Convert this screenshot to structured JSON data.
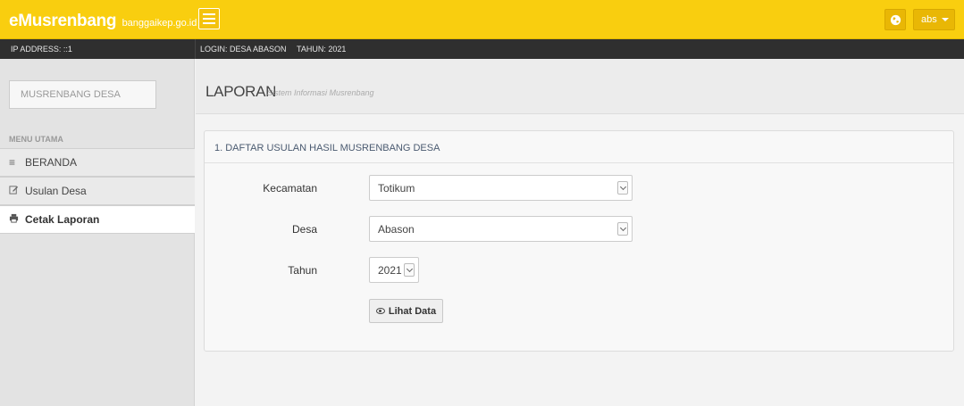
{
  "brand": {
    "name": "eMusrenbang",
    "domain": "banggaikep.go.id"
  },
  "topbar": {
    "user_label": "abs",
    "accent": "#f9ce0f"
  },
  "infobar": {
    "ip": "IP ADDRESS: ::1",
    "login": "LOGIN: DESA ABASON",
    "tahun": "TAHUN: 2021"
  },
  "sidebar": {
    "search_label": "MUSRENBANG DESA",
    "menu_header": "MENU UTAMA",
    "items": [
      {
        "label": "BERANDA",
        "icon": "list-icon"
      },
      {
        "label": "Usulan Desa",
        "icon": "edit-icon"
      },
      {
        "label": "Cetak Laporan",
        "icon": "print-icon",
        "active": true
      }
    ]
  },
  "page": {
    "title": "LAPORAN",
    "subtitle": "Sistem Informasi Musrenbang"
  },
  "panel": {
    "heading": "1. DAFTAR USULAN HASIL MUSRENBANG DESA",
    "fields": {
      "kecamatan": {
        "label": "Kecamatan",
        "value": "Totikum"
      },
      "desa": {
        "label": "Desa",
        "value": "Abason"
      },
      "tahun": {
        "label": "Tahun",
        "value": "2021"
      }
    },
    "button_label": "Lihat Data"
  }
}
